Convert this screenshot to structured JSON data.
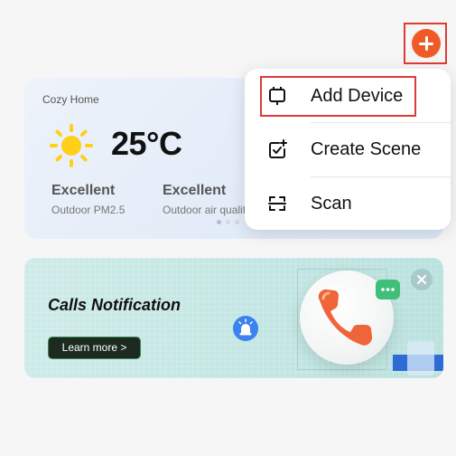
{
  "home": {
    "name": "Cozy Home",
    "temperature": "25°C",
    "weather_icon": "sun-icon",
    "metrics": [
      {
        "value": "Excellent",
        "label": "Outdoor PM2.5"
      },
      {
        "value": "Excellent",
        "label": "Outdoor air quality"
      }
    ],
    "page_indicator": {
      "pages": 3,
      "current": 1
    }
  },
  "add_button": {
    "icon": "plus-icon"
  },
  "menu": {
    "items": [
      {
        "label": "Add Device",
        "icon": "add-device-icon"
      },
      {
        "label": "Create Scene",
        "icon": "create-scene-icon"
      },
      {
        "label": "Scan",
        "icon": "scan-icon"
      }
    ]
  },
  "banner": {
    "title": "Calls Notification",
    "cta": "Learn more >",
    "illustration": "phone-icon"
  },
  "colors": {
    "accent": "#f05a28",
    "highlight": "#e03a36",
    "alarm": "#3b82f0",
    "phone": "#f0643a",
    "chat": "#3fbf7a"
  }
}
